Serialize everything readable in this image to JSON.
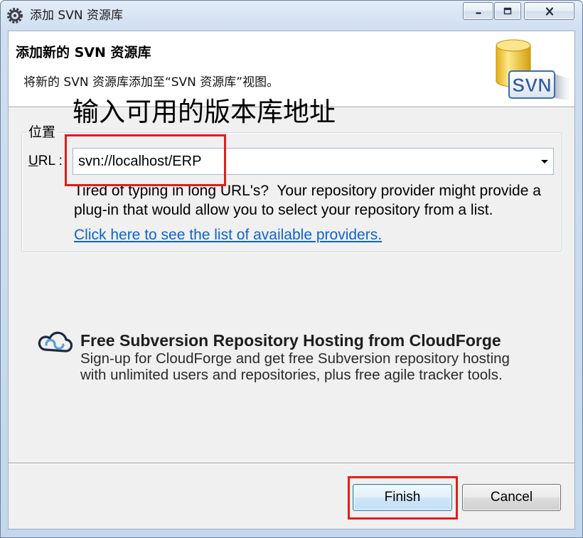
{
  "window": {
    "title": "添加 SVN 资源库"
  },
  "header": {
    "title": "添加新的 SVN 资源库",
    "description": "将新的 SVN 资源库添加至“SVN 资源库”视图。",
    "logo_text": "SVN"
  },
  "annotation": {
    "text": "输入可用的版本库地址"
  },
  "location": {
    "group_label": "位置",
    "url_label": "URL :",
    "url_value": "svn://localhost/ERP",
    "hint_line_1": "Tired of typing in long URL's?  Your repository provider might provide a",
    "hint_line_2": "plug-in that would allow you to select your repository from a list.",
    "providers_link": "Click here to see the list of available providers."
  },
  "cloudforge": {
    "title": "Free Subversion Repository Hosting from CloudForge",
    "line_1": "Sign-up for CloudForge and get free Subversion repository hosting",
    "line_2": "with unlimited users and repositories, plus free agile tracker tools."
  },
  "buttons": {
    "finish": "Finish",
    "cancel": "Cancel",
    "finish_is_default": true
  },
  "icons": {
    "app": "eclipse-icon",
    "minimize": "minimize-icon",
    "maximize": "maximize-icon",
    "close": "close-icon",
    "header_logo": "svn-repository-icon",
    "combo_arrow": "chevron-down-icon",
    "cloudforge": "cloudforge-icon"
  },
  "colors": {
    "title_bar": "#cfdef1",
    "header_background": "#ffffff",
    "body_background": "#f0f0f0",
    "link": "#0b63ce",
    "annotation_red": "#e31c1c",
    "default_button_border": "#3c7fb1",
    "logo_yellow": "#f5cf3c",
    "logo_blue": "#2c5ea5"
  }
}
